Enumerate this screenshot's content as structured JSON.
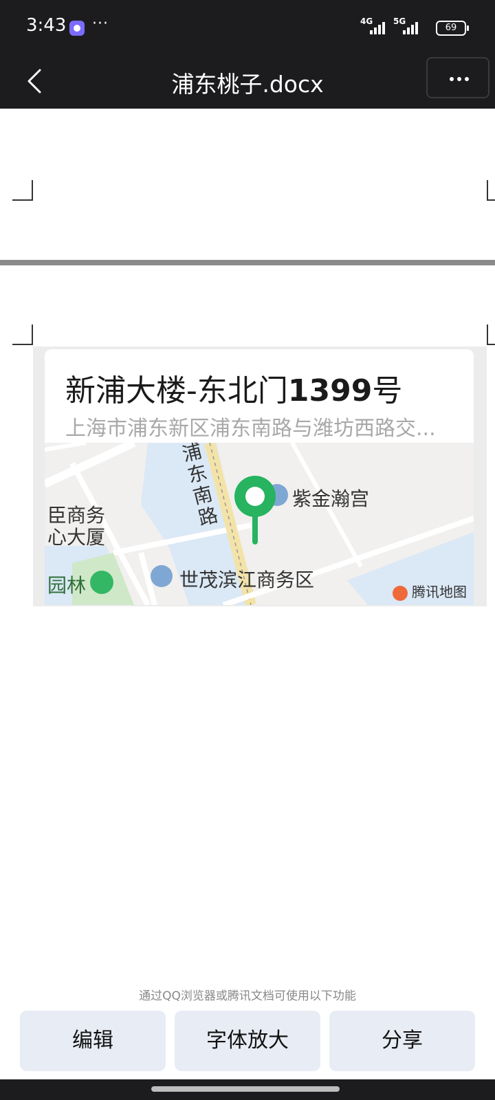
{
  "status_bar": {
    "time": "3:43",
    "dots": "···",
    "signal_1": "4G",
    "signal_2": "5G",
    "battery": "69"
  },
  "nav": {
    "title": "浦东桃子.docx"
  },
  "map_card": {
    "name_text": "新浦大楼-东北门",
    "name_number": "1399",
    "name_suffix": "号",
    "address": "上海市浦东新区浦东南路与潍坊西路交...",
    "labels": {
      "road": "浦东南路",
      "poi_1": "紫金瀚宫",
      "poi_2_line1": "臣商务",
      "poi_2_line2": "心大厦",
      "poi_3": "世茂滨江商务区",
      "poi_4": "园林",
      "provider": "腾讯地图"
    }
  },
  "footer": {
    "hint": "通过QQ浏览器或腾讯文档可使用以下功能",
    "buttons": [
      "编辑",
      "字体放大",
      "分享"
    ]
  }
}
